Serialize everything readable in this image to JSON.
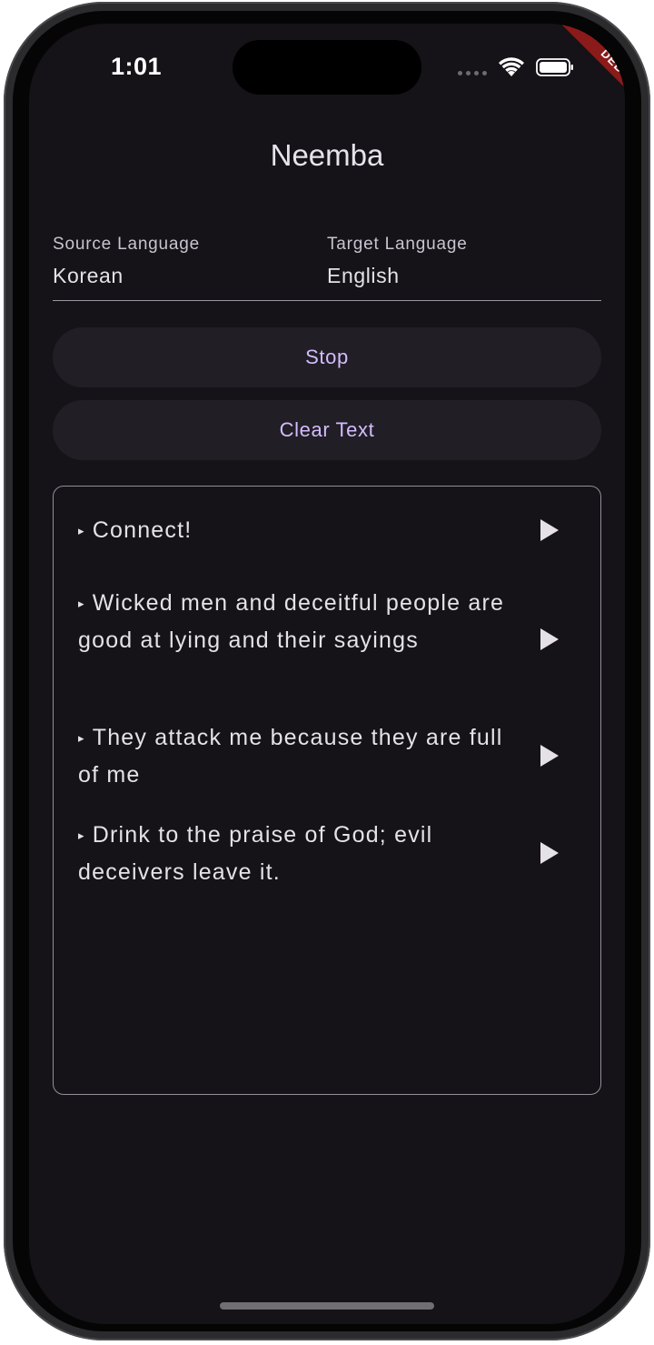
{
  "status_bar": {
    "time": "1:01",
    "icons": [
      "signal-dots-icon",
      "wifi-icon",
      "battery-icon"
    ]
  },
  "debug_banner": "DEBUG",
  "app": {
    "title": "Neemba"
  },
  "languages": {
    "source_label": "Source Language",
    "source_value": "Korean",
    "target_label": "Target Language",
    "target_value": "English"
  },
  "buttons": {
    "stop_label": "Stop",
    "clear_label": "Clear Text"
  },
  "output": {
    "bullet": "▸",
    "entries": [
      {
        "text": "Connect!"
      },
      {
        "text": "Wicked men and deceitful people are good at lying and their sayings"
      },
      {
        "text": "They attack me because they are full of me"
      },
      {
        "text": "Drink to the praise of God; evil deceivers leave it."
      }
    ]
  },
  "colors": {
    "background": "#151218",
    "accent": "#d3bcfd",
    "button_bg": "#211e25",
    "text": "#e6e1e6",
    "debug_banner": "#8b1a1a"
  }
}
